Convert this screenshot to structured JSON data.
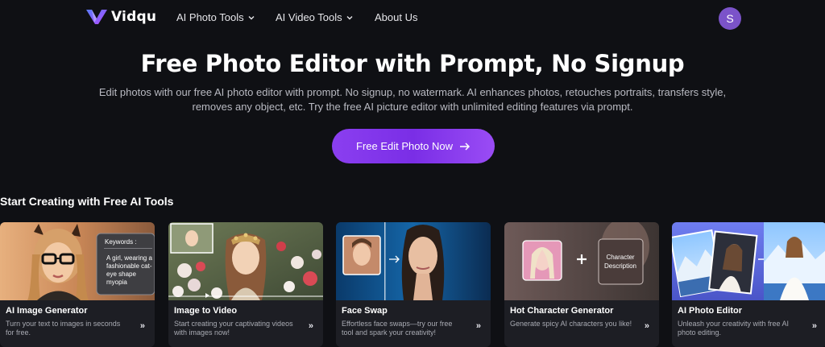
{
  "nav": {
    "logo_text": "Vidqu",
    "items": [
      {
        "label": "AI Photo Tools"
      },
      {
        "label": "AI Video Tools"
      },
      {
        "label": "About Us"
      }
    ],
    "avatar_letter": "S"
  },
  "hero": {
    "title": "Free Photo Editor with Prompt, No Signup",
    "description_line1": "Edit photos with our free AI photo editor with prompt. No signup, no watermark. AI enhances photos, retouches portraits, transfers style,",
    "description_line2": "removes any object, etc. Try the free AI picture editor with unlimited editing features via prompt.",
    "cta_label": "Free Edit Photo Now"
  },
  "section_title": "Start Creating with Free AI Tools",
  "cards": [
    {
      "title": "AI Image Generator",
      "description": "Turn your text to images in seconds for free.",
      "keywords_label": "Keywords :",
      "keywords_text_1": "A girl, wearing a",
      "keywords_text_2": "fashionable cat-",
      "keywords_text_3": "eye shape",
      "keywords_text_4": "myopia"
    },
    {
      "title": "Image to Video",
      "description": "Start creating your captivating videos with images now!"
    },
    {
      "title": "Face Swap",
      "description": "Effortless face swaps—try our free tool and spark your creativity!"
    },
    {
      "title": "Hot Character Generator",
      "description": "Generate spicy AI characters you like!",
      "badge_line1": "Character",
      "badge_line2": "Description"
    },
    {
      "title": "AI Photo Editor",
      "description": "Unleash your creativity with free AI photo editing."
    }
  ],
  "colors": {
    "background": "#0f1014",
    "accent": "#8b3ff0",
    "avatar": "#7b53c9",
    "card_bg": "#1d1e24"
  }
}
